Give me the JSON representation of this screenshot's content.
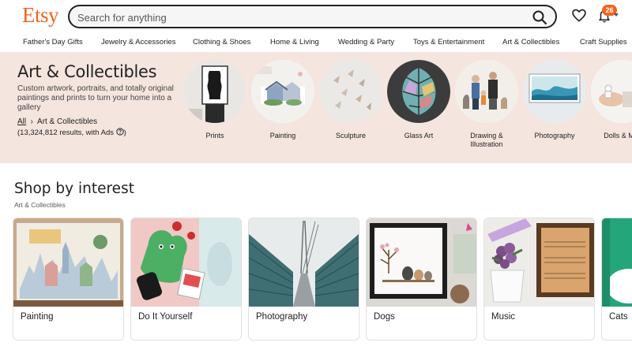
{
  "header": {
    "logo": "Etsy",
    "search_placeholder": "Search for anything",
    "notification_count": "26"
  },
  "nav": {
    "categories": [
      "Father's Day Gifts",
      "Jewelry & Accessories",
      "Clothing & Shoes",
      "Home & Living",
      "Wedding & Party",
      "Toys & Entertainment",
      "Art & Collectibles",
      "Craft Supplies"
    ]
  },
  "banner": {
    "title": "Art & Collectibles",
    "description": "Custom artwork, portraits, and totally original paintings and prints to turn your home into a gallery",
    "breadcrumb_all": "All",
    "breadcrumb_current": "Art & Collectibles",
    "results_text": "(13,324,812 results, with Ads",
    "results_close": ")",
    "subcategories": [
      {
        "label": "Prints",
        "icon": "black-sculpture-print"
      },
      {
        "label": "Painting",
        "icon": "house-painting"
      },
      {
        "label": "Sculpture",
        "icon": "paper-birds"
      },
      {
        "label": "Glass Art",
        "icon": "glass-leaf"
      },
      {
        "label": "Drawing & Illustration",
        "icon": "family-portrait"
      },
      {
        "label": "Photography",
        "icon": "ocean-photo"
      },
      {
        "label": "Dolls & Mini",
        "icon": "mini-dolls"
      }
    ]
  },
  "shop_by_interest": {
    "title": "Shop by interest",
    "subtitle": "Art & Collectibles",
    "cards": [
      {
        "label": "Painting"
      },
      {
        "label": "Do It Yourself"
      },
      {
        "label": "Photography"
      },
      {
        "label": "Dogs"
      },
      {
        "label": "Music"
      },
      {
        "label": "Cats"
      }
    ]
  },
  "colors": {
    "brand": "#f1641e",
    "banner_bg": "#f5e5df"
  }
}
